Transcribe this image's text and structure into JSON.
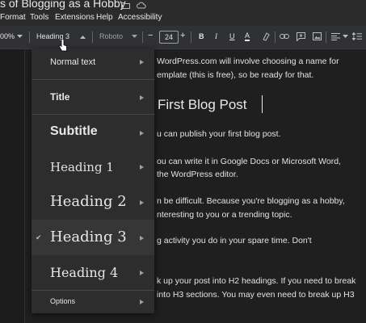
{
  "window": {
    "title": "s of Blogging as a Hobby"
  },
  "menubar": {
    "items": [
      "Format",
      "Tools",
      "Extensions",
      "Help",
      "Accessibility"
    ]
  },
  "toolbar": {
    "zoom": "00%",
    "style_label": "Heading 3",
    "font_label": "Roboto",
    "font_size": "24",
    "minus": "−",
    "plus": "+",
    "bold": "B",
    "italic": "I",
    "underline": "U",
    "text_color": "A"
  },
  "document": {
    "lines": [
      "WordPress.com will involve choosing a name for",
      "emplate (this is free), so be ready for that.",
      "u can publish your first blog post.",
      "ou can write it in Google Docs or Microsoft Word,",
      "the WordPress editor.",
      "n be difficult. Because you're blogging as a hobby,",
      "nteresting to you or a trending topic.",
      "g activity you do in your spare time. Don't",
      "k up your post into H2 headings. If you need to break",
      "into H3 sections. You may even need to break up H3"
    ],
    "heading": "First Blog Post"
  },
  "style_menu": {
    "items": [
      {
        "label": "Normal text",
        "selected": false
      },
      {
        "label": "Title",
        "selected": false
      },
      {
        "label": "Subtitle",
        "selected": false
      },
      {
        "label": "Heading 1",
        "selected": false
      },
      {
        "label": "Heading 2",
        "selected": false
      },
      {
        "label": "Heading 3",
        "selected": true
      },
      {
        "label": "Heading 4",
        "selected": false
      }
    ],
    "options_label": "Options",
    "check_glyph": "✔"
  }
}
